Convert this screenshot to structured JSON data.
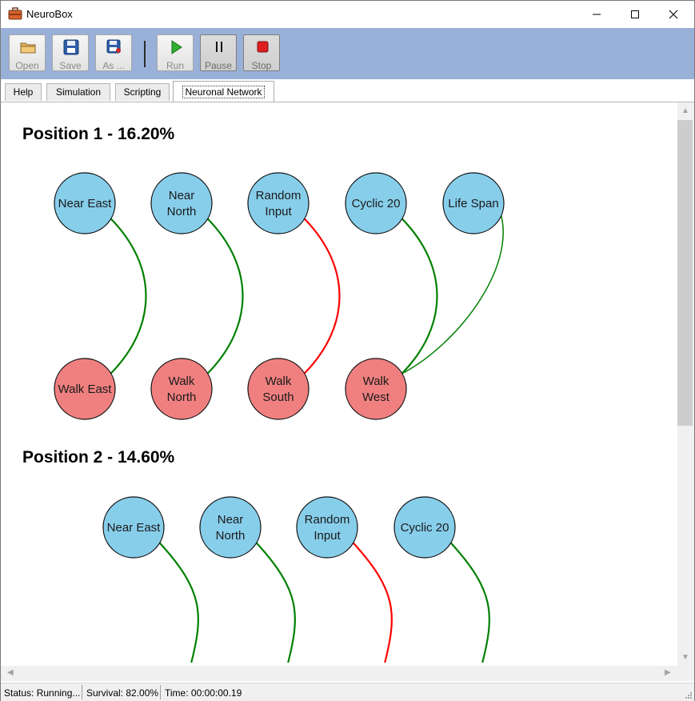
{
  "window": {
    "title": "NeuroBox"
  },
  "toolbar": {
    "open_label": "Open",
    "save_label": "Save",
    "saveas_label": "As ...",
    "run_label": "Run",
    "pause_label": "Pause",
    "stop_label": "Stop"
  },
  "tabs": [
    {
      "label": "Help"
    },
    {
      "label": "Simulation"
    },
    {
      "label": "Scripting"
    },
    {
      "label": "Neuronal Network",
      "active": true
    }
  ],
  "positions": [
    {
      "title": "Position 1 - 16.20%",
      "inputs": [
        [
          "Near East"
        ],
        [
          "Near",
          "North"
        ],
        [
          "Random",
          "Input"
        ],
        [
          "Cyclic 20"
        ],
        [
          "Life Span"
        ]
      ],
      "outputs": [
        [
          "Walk East"
        ],
        [
          "Walk",
          "North"
        ],
        [
          "Walk",
          "South"
        ],
        [
          "Walk",
          "West"
        ]
      ],
      "links": [
        {
          "from": "Near East",
          "to": "Walk East",
          "sign": "positive"
        },
        {
          "from": "Near North",
          "to": "Walk North",
          "sign": "positive"
        },
        {
          "from": "Random Input",
          "to": "Walk South",
          "sign": "negative"
        },
        {
          "from": "Cyclic 20",
          "to": "Walk West",
          "sign": "positive"
        },
        {
          "from": "Life Span",
          "to": "Walk West",
          "sign": "positive"
        }
      ]
    },
    {
      "title": "Position 2 - 14.60%",
      "inputs": [
        [
          "Near East"
        ],
        [
          "Near",
          "North"
        ],
        [
          "Random",
          "Input"
        ],
        [
          "Cyclic 20"
        ]
      ],
      "outputs": [],
      "links": [
        {
          "from": "Near East",
          "sign": "positive"
        },
        {
          "from": "Near North",
          "sign": "positive"
        },
        {
          "from": "Random Input",
          "sign": "negative"
        },
        {
          "from": "Cyclic 20",
          "sign": "positive"
        }
      ]
    }
  ],
  "status": {
    "state": "Status: Running...",
    "survival": "Survival: 82.00%",
    "time": "Time: 00:00:00.19"
  },
  "colors": {
    "input_node": "#87ceeb",
    "output_node": "#f08080",
    "positive_link": "#008000",
    "negative_link": "#ff0000",
    "toolbar_bg": "#99b0d8"
  }
}
